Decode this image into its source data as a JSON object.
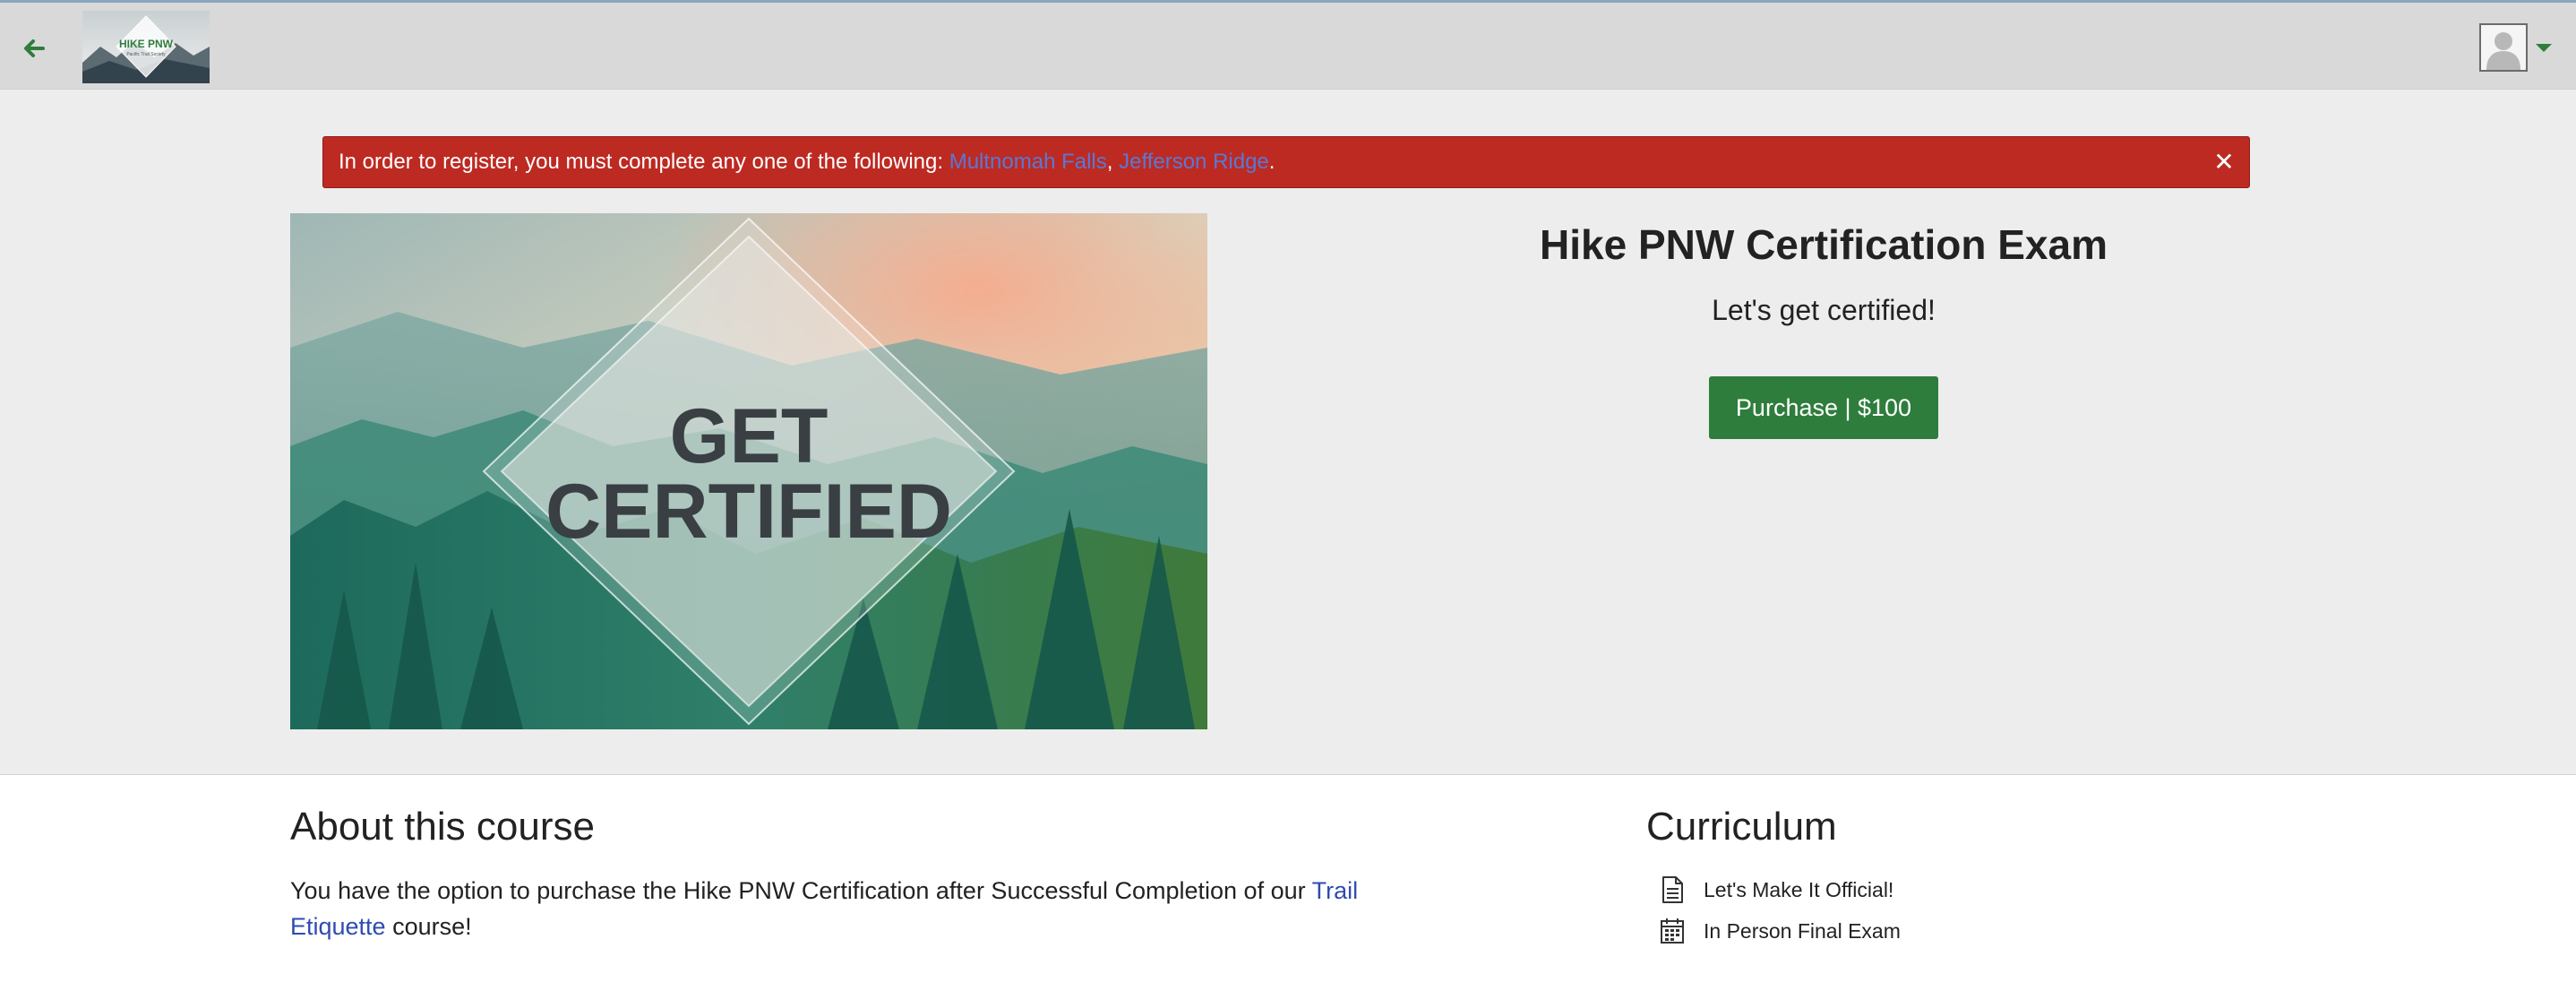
{
  "header": {
    "back_icon": "arrow-left-icon",
    "logo_text": "HIKE PNW",
    "logo_tagline": "Pacific Trail Society",
    "avatar_icon": "user-icon",
    "menu_icon": "caret-down-icon"
  },
  "alert": {
    "message": "In order to register, you must complete any one of the following: ",
    "requirements": [
      "Multnomah Falls",
      "Jefferson Ridge"
    ],
    "separator": ", ",
    "end": ".",
    "close_label": "✕",
    "color": "#bd2a22"
  },
  "course": {
    "image_text_line1": "GET",
    "image_text_line2": "CERTIFIED",
    "title": "Hike PNW Certification Exam",
    "subtitle": "Let's get certified!",
    "purchase_label": "Purchase | $100",
    "accent": "#2e7d3c"
  },
  "about": {
    "heading": "About this course",
    "text_before": "You have the option to purchase the Hike PNW Certification after Successful Completion of our ",
    "link_text": "Trail Etiquette",
    "text_after": " course!"
  },
  "curriculum": {
    "heading": "Curriculum",
    "items": [
      {
        "icon": "document-icon",
        "label": "Let's Make It Official!"
      },
      {
        "icon": "calendar-icon",
        "label": "In Person Final Exam"
      }
    ]
  }
}
